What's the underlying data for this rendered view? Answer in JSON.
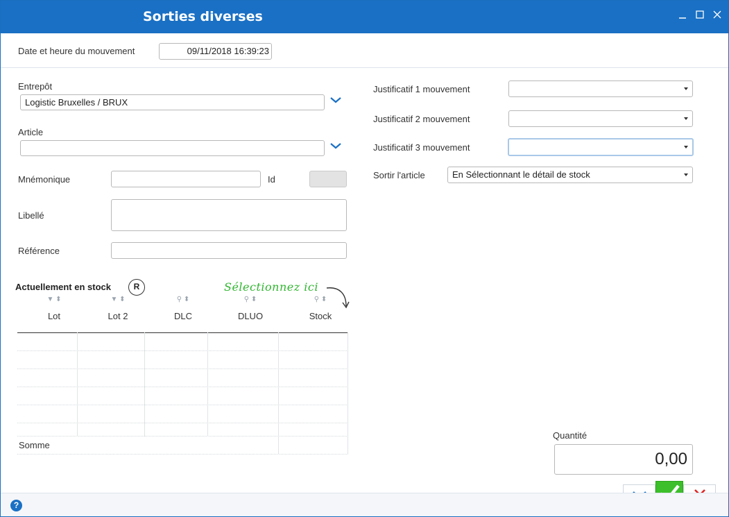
{
  "window": {
    "title": "Sorties diverses"
  },
  "header": {
    "datetime_label": "Date et heure du mouvement",
    "datetime_value": "09/11/2018 16:39:23"
  },
  "left": {
    "entrepot_label": "Entrepôt",
    "entrepot_value": "Logistic Bruxelles / BRUX",
    "article_label": "Article",
    "article_value": "",
    "mnemonique_label": "Mnémonique",
    "mnemonique_value": "",
    "id_label": "Id",
    "id_value": "",
    "libelle_label": "Libellé",
    "libelle_value": "",
    "reference_label": "Référence",
    "reference_value": ""
  },
  "right": {
    "justif1_label": "Justificatif 1 mouvement",
    "justif1_value": "",
    "justif2_label": "Justificatif 2 mouvement",
    "justif2_value": "",
    "justif3_label": "Justificatif 3 mouvement",
    "justif3_value": "",
    "sortir_label": "Sortir l'article",
    "sortir_value": "En Sélectionnant le détail de stock"
  },
  "stock": {
    "title": "Actuellement en stock",
    "badge": "R",
    "hint": "Sélectionnez ici",
    "columns": [
      "Lot",
      "Lot 2",
      "DLC",
      "DLUO",
      "Stock"
    ],
    "sum_label": "Somme"
  },
  "quantity": {
    "label": "Quantité",
    "value": "0,00"
  },
  "footer": {
    "help": "?"
  },
  "colors": {
    "accent": "#1a70c4",
    "ok": "#3cbf2a",
    "cancel": "#e02424",
    "hint": "#2fb62f"
  },
  "icons": {
    "minimize": "minimize-icon",
    "maximize": "maximize-icon",
    "close": "close-icon",
    "dropdown": "chevron-down-icon",
    "filter": "filter-icon",
    "search": "search-icon",
    "help": "help-icon",
    "confirm": "check-icon",
    "cancel": "x-icon"
  }
}
